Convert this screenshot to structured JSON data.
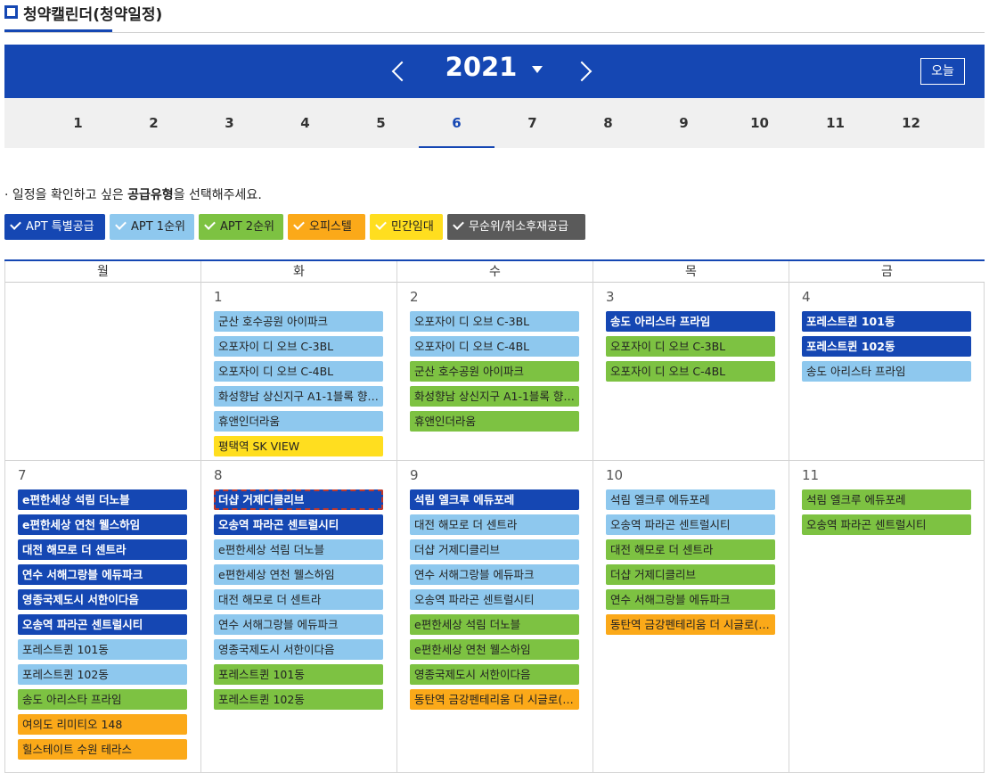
{
  "header": {
    "title": "청약캘린더(청약일정)"
  },
  "year_nav": {
    "year": "2021",
    "today_label": "오늘"
  },
  "months": [
    "1",
    "2",
    "3",
    "4",
    "5",
    "6",
    "7",
    "8",
    "9",
    "10",
    "11",
    "12"
  ],
  "active_month": "6",
  "notice": {
    "prefix": "· 일정을 확인하고 싶은 ",
    "bold": "공급유형",
    "suffix": "을 선택해주세요."
  },
  "filters": [
    {
      "label": "APT 특별공급",
      "color": "#1547b3"
    },
    {
      "label": "APT 1순위",
      "color": "#8ec8ee"
    },
    {
      "label": "APT 2순위",
      "color": "#7dc242"
    },
    {
      "label": "오피스텔",
      "color": "#fba919"
    },
    {
      "label": "민간임대",
      "color": "#ffde1f"
    },
    {
      "label": "무순위/취소후재공급",
      "color": "#5a5a5a"
    }
  ],
  "weekdays": [
    "월",
    "화",
    "수",
    "목",
    "금"
  ],
  "weeks": [
    [
      {
        "day": "",
        "events": []
      },
      {
        "day": "1",
        "events": [
          {
            "name": "군산 호수공원 아이파크",
            "type": 2
          },
          {
            "name": "오포자이 디 오브 C-3BL",
            "type": 2
          },
          {
            "name": "오포자이 디 오브 C-4BL",
            "type": 2
          },
          {
            "name": "화성향남 상신지구 A1-1블록 향…",
            "type": 2
          },
          {
            "name": "휴앤인더라움",
            "type": 2
          },
          {
            "name": "평택역 SK VIEW",
            "type": 5
          }
        ]
      },
      {
        "day": "2",
        "events": [
          {
            "name": "오포자이 디 오브 C-3BL",
            "type": 2
          },
          {
            "name": "오포자이 디 오브 C-4BL",
            "type": 2
          },
          {
            "name": "군산 호수공원 아이파크",
            "type": 3
          },
          {
            "name": "화성향남 상신지구 A1-1블록 향…",
            "type": 3
          },
          {
            "name": "휴앤인더라움",
            "type": 3
          }
        ]
      },
      {
        "day": "3",
        "events": [
          {
            "name": "송도 아리스타 프라임",
            "type": 1
          },
          {
            "name": "오포자이 디 오브 C-3BL",
            "type": 3
          },
          {
            "name": "오포자이 디 오브 C-4BL",
            "type": 3
          }
        ]
      },
      {
        "day": "4",
        "events": [
          {
            "name": "포레스트퀸 101동",
            "type": 1
          },
          {
            "name": "포레스트퀸 102동",
            "type": 1
          },
          {
            "name": "송도 아리스타 프라임",
            "type": 2
          }
        ]
      }
    ],
    [
      {
        "day": "7",
        "events": [
          {
            "name": "e편한세상 석림 더노블",
            "type": 1
          },
          {
            "name": "e편한세상 연천 웰스하임",
            "type": 1
          },
          {
            "name": "대전 해모로 더 센트라",
            "type": 1
          },
          {
            "name": "연수 서해그랑블 에듀파크",
            "type": 1
          },
          {
            "name": "영종국제도시 서한이다음",
            "type": 1
          },
          {
            "name": "오송역 파라곤 센트럴시티",
            "type": 1
          },
          {
            "name": "포레스트퀸 101동",
            "type": 2
          },
          {
            "name": "포레스트퀸 102동",
            "type": 2
          },
          {
            "name": "송도 아리스타 프라임",
            "type": 3
          },
          {
            "name": "여의도 리미티오 148",
            "type": 4
          },
          {
            "name": "힐스테이트 수원 테라스",
            "type": 4
          }
        ]
      },
      {
        "day": "8",
        "events": [
          {
            "name": "더샵 거제디클리브",
            "type": 1,
            "selected": true
          },
          {
            "name": "오송역 파라곤 센트럴시티",
            "type": 1
          },
          {
            "name": "e편한세상 석림 더노블",
            "type": 2
          },
          {
            "name": "e편한세상 연천 웰스하임",
            "type": 2
          },
          {
            "name": "대전 해모로 더 센트라",
            "type": 2
          },
          {
            "name": "연수 서해그랑블 에듀파크",
            "type": 2
          },
          {
            "name": "영종국제도시 서한이다음",
            "type": 2
          },
          {
            "name": "포레스트퀸 101동",
            "type": 3
          },
          {
            "name": "포레스트퀸 102동",
            "type": 3
          }
        ]
      },
      {
        "day": "9",
        "events": [
          {
            "name": "석림 엘크루 에듀포레",
            "type": 1
          },
          {
            "name": "대전 해모로 더 센트라",
            "type": 2
          },
          {
            "name": "더샵 거제디클리브",
            "type": 2
          },
          {
            "name": "연수 서해그랑블 에듀파크",
            "type": 2
          },
          {
            "name": "오송역 파라곤 센트럴시티",
            "type": 2
          },
          {
            "name": "e편한세상 석림 더노블",
            "type": 3
          },
          {
            "name": "e편한세상 연천 웰스하임",
            "type": 3
          },
          {
            "name": "영종국제도시 서한이다음",
            "type": 3
          },
          {
            "name": "동탄역 금강펜테리움 더 시글로(…",
            "type": 4
          }
        ]
      },
      {
        "day": "10",
        "events": [
          {
            "name": "석림 엘크루 에듀포레",
            "type": 2
          },
          {
            "name": "오송역 파라곤 센트럴시티",
            "type": 2
          },
          {
            "name": "대전 해모로 더 센트라",
            "type": 3
          },
          {
            "name": "더샵 거제디클리브",
            "type": 3
          },
          {
            "name": "연수 서해그랑블 에듀파크",
            "type": 3
          },
          {
            "name": "동탄역 금강펜테리움 더 시글로(…",
            "type": 4
          }
        ]
      },
      {
        "day": "11",
        "events": [
          {
            "name": "석림 엘크루 에듀포레",
            "type": 3
          },
          {
            "name": "오송역 파라곤 센트럴시티",
            "type": 3
          }
        ]
      }
    ]
  ]
}
